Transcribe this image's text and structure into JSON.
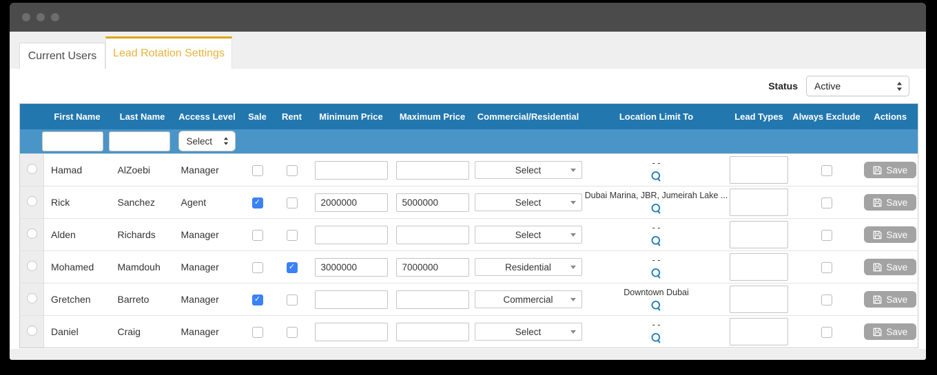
{
  "tabs": [
    {
      "label": "Current Users",
      "active": false
    },
    {
      "label": "Lead Rotation Settings",
      "active": true
    }
  ],
  "status": {
    "label": "Status",
    "value": "Active"
  },
  "table": {
    "columns": [
      "First Name",
      "Last Name",
      "Access Level",
      "Sale",
      "Rent",
      "Minimum Price",
      "Maximum Price",
      "Commercial/Residential",
      "Location Limit To",
      "Lead Types",
      "Always Exclude",
      "Actions"
    ],
    "filter": {
      "first_name": "",
      "last_name": "",
      "access_level": "Select"
    },
    "save_label": "Save",
    "rows": [
      {
        "first_name": "Hamad",
        "last_name": "AlZoebi",
        "access_level": "Manager",
        "sale": false,
        "rent": false,
        "min_price": "",
        "max_price": "",
        "commercial_residential": "Select",
        "location_limit": "- -",
        "lead_types": "",
        "always_exclude": false
      },
      {
        "first_name": "Rick",
        "last_name": "Sanchez",
        "access_level": "Agent",
        "sale": true,
        "rent": false,
        "min_price": "2000000",
        "max_price": "5000000",
        "commercial_residential": "Select",
        "location_limit": "Dubai Marina, JBR, Jumeirah Lake ...",
        "lead_types": "",
        "always_exclude": false
      },
      {
        "first_name": "Alden",
        "last_name": "Richards",
        "access_level": "Manager",
        "sale": false,
        "rent": false,
        "min_price": "",
        "max_price": "",
        "commercial_residential": "Select",
        "location_limit": "- -",
        "lead_types": "",
        "always_exclude": false
      },
      {
        "first_name": "Mohamed",
        "last_name": "Mamdouh",
        "access_level": "Manager",
        "sale": false,
        "rent": true,
        "min_price": "3000000",
        "max_price": "7000000",
        "commercial_residential": "Residential",
        "location_limit": "- -",
        "lead_types": "",
        "always_exclude": false
      },
      {
        "first_name": "Gretchen",
        "last_name": "Barreto",
        "access_level": "Manager",
        "sale": true,
        "rent": false,
        "min_price": "",
        "max_price": "",
        "commercial_residential": "Commercial",
        "location_limit": "Downtown Dubai",
        "lead_types": "",
        "always_exclude": false
      },
      {
        "first_name": "Daniel",
        "last_name": "Craig",
        "access_level": "Manager",
        "sale": false,
        "rent": false,
        "min_price": "",
        "max_price": "",
        "commercial_residential": "Select",
        "location_limit": "- -",
        "lead_types": "",
        "always_exclude": false
      }
    ]
  },
  "icons": {
    "window_controls": "three-dots",
    "search": "magnifier",
    "save": "floppy-disk",
    "row_dropdown": "caret-down",
    "native_select": "up-down-spinner"
  },
  "colors": {
    "titlebar": "#4b4b4b",
    "tab_accent": "#dfa613",
    "tab_active_text": "#e9b23b",
    "header_blue": "#2277af",
    "filter_blue": "#4a95c8",
    "checked_blue": "#3b82f6",
    "search_icon_blue": "#2980b9",
    "save_gray": "#a3a3a3"
  }
}
